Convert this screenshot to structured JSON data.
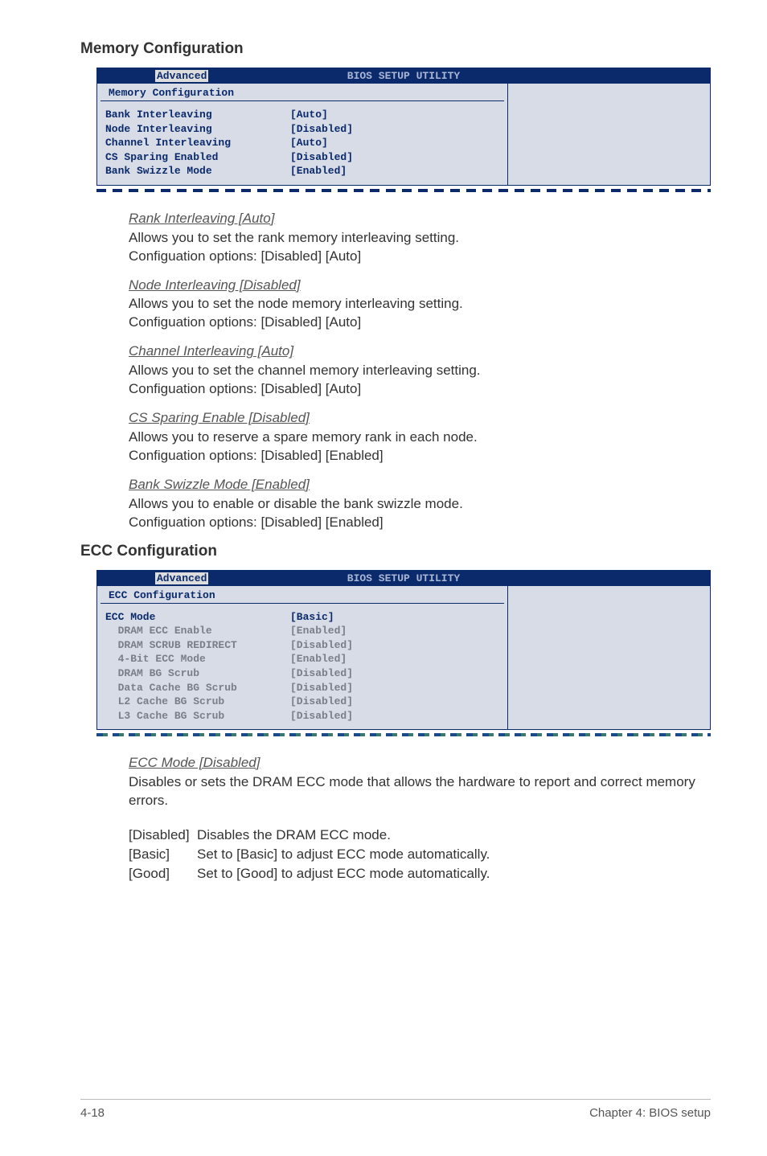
{
  "sections": {
    "mem": {
      "title": "Memory Configuration",
      "bios": {
        "header": "BIOS SETUP UTILITY",
        "tab": "Advanced",
        "subheader": "Memory Configuration",
        "rows": [
          {
            "k": "Bank Interleaving",
            "v": "[Auto]",
            "cls": "blue-text"
          },
          {
            "k": "Node Interleaving",
            "v": "[Disabled]",
            "cls": "blue-text"
          },
          {
            "k": "Channel Interleaving",
            "v": "[Auto]",
            "cls": "blue-text"
          },
          {
            "k": "CS Sparing Enabled",
            "v": "[Disabled]",
            "cls": "blue-text"
          },
          {
            "k": "Bank Swizzle Mode",
            "v": "[Enabled]",
            "cls": "blue-text"
          }
        ]
      },
      "items": [
        {
          "title": "Rank Interleaving [Auto]",
          "l1": "Allows you to set the rank memory interleaving setting.",
          "l2": "Configuation options: [Disabled] [Auto]"
        },
        {
          "title": "Node Interleaving [Disabled]",
          "l1": "Allows you to set the node memory interleaving setting.",
          "l2": "Configuation options: [Disabled] [Auto]"
        },
        {
          "title": "Channel Interleaving [Auto]",
          "l1": "Allows you to set the channel memory interleaving setting.",
          "l2": "Configuation options: [Disabled] [Auto]"
        },
        {
          "title": "CS Sparing Enable [Disabled]",
          "l1": "Allows you to reserve a spare memory rank in each node.",
          "l2": "Configuation options: [Disabled] [Enabled]"
        },
        {
          "title": "Bank Swizzle Mode [Enabled]",
          "l1": "Allows you to enable or disable the bank swizzle mode.",
          "l2": "Configuation options: [Disabled] [Enabled]"
        }
      ]
    },
    "ecc": {
      "title": "ECC Configuration",
      "bios": {
        "header": "BIOS SETUP UTILITY",
        "tab": "Advanced",
        "subheader": "ECC Configuration",
        "rows": [
          {
            "k": "ECC Mode",
            "v": "[Basic]",
            "cls": "blue-text",
            "indent": false
          },
          {
            "k": "DRAM ECC Enable",
            "v": "[Enabled]",
            "cls": "gray-text",
            "indent": true
          },
          {
            "k": "DRAM SCRUB REDIRECT",
            "v": "[Disabled]",
            "cls": "gray-text",
            "indent": true
          },
          {
            "k": "4-Bit ECC Mode",
            "v": "[Enabled]",
            "cls": "gray-text",
            "indent": true
          },
          {
            "k": "DRAM BG Scrub",
            "v": "[Disabled]",
            "cls": "gray-text",
            "indent": true
          },
          {
            "k": "Data Cache BG Scrub",
            "v": "[Disabled]",
            "cls": "gray-text",
            "indent": true
          },
          {
            "k": "L2 Cache BG Scrub",
            "v": "[Disabled]",
            "cls": "gray-text",
            "indent": true
          },
          {
            "k": "L3 Cache BG Scrub",
            "v": "[Disabled]",
            "cls": "gray-text",
            "indent": true
          }
        ]
      },
      "items": [
        {
          "title": "ECC Mode [Disabled]",
          "l1": "Disables or sets the DRAM ECC mode that allows the hardware to report and correct memory errors.",
          "l2": ""
        }
      ],
      "opts": [
        {
          "k": "[Disabled]",
          "v": "Disables the DRAM ECC mode."
        },
        {
          "k": "[Basic]",
          "v": "Set to [Basic] to adjust ECC mode automatically."
        },
        {
          "k": "[Good]",
          "v": "Set to [Good] to adjust ECC mode automatically."
        }
      ]
    }
  },
  "footer": {
    "left": "4-18",
    "right": "Chapter 4: BIOS setup"
  }
}
